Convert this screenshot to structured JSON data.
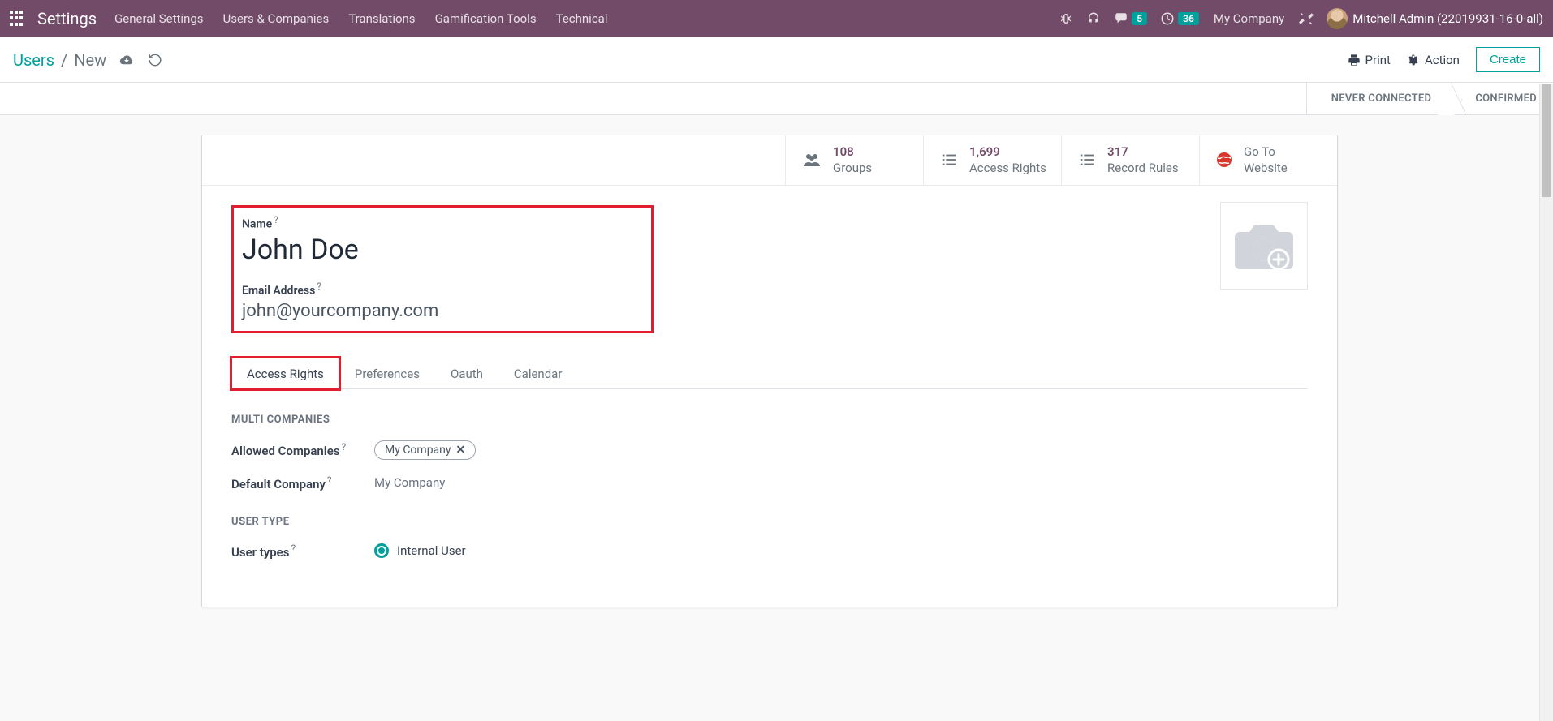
{
  "topnav": {
    "app_title": "Settings",
    "menu": [
      "General Settings",
      "Users & Companies",
      "Translations",
      "Gamification Tools",
      "Technical"
    ],
    "messages_badge": "5",
    "activities_badge": "36",
    "company": "My Company",
    "username": "Mitchell Admin (22019931-16-0-all)"
  },
  "control_panel": {
    "crumb_root": "Users",
    "crumb_current": "New",
    "print": "Print",
    "action": "Action",
    "create": "Create"
  },
  "statusbar": {
    "step1": "NEVER CONNECTED",
    "step2": "CONFIRMED"
  },
  "button_box": {
    "groups": {
      "count": "108",
      "label": "Groups"
    },
    "rights": {
      "count": "1,699",
      "label": "Access Rights"
    },
    "rules": {
      "count": "317",
      "label": "Record Rules"
    },
    "website": {
      "line1": "Go To",
      "line2": "Website"
    }
  },
  "title_area": {
    "name_caption": "Name",
    "name_value": "John Doe",
    "email_caption": "Email Address",
    "email_value": "john@yourcompany.com",
    "help_marker": "?"
  },
  "tabs": [
    "Access Rights",
    "Preferences",
    "Oauth",
    "Calendar"
  ],
  "sections": {
    "multi_companies": {
      "heading": "MULTI COMPANIES",
      "allowed_label": "Allowed Companies",
      "allowed_tag": "My Company",
      "default_label": "Default Company",
      "default_value": "My Company"
    },
    "user_type": {
      "heading": "USER TYPE",
      "label": "User types",
      "value": "Internal User"
    }
  }
}
